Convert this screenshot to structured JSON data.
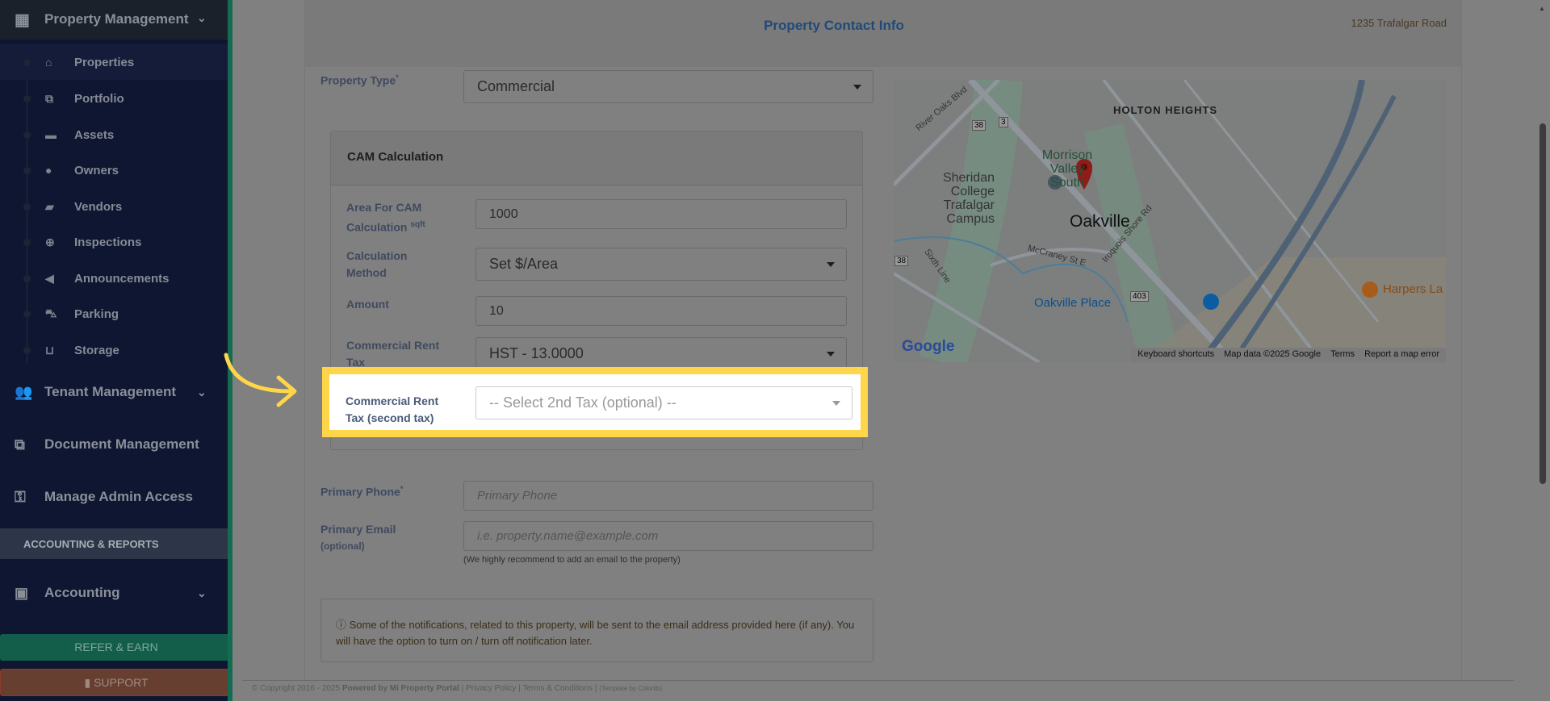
{
  "sidebar": {
    "section_title": "Property Management",
    "sub_items": [
      {
        "label": "Properties",
        "icon": "home-icon"
      },
      {
        "label": "Portfolio",
        "icon": "portfolio-icon"
      },
      {
        "label": "Assets",
        "icon": "archive-icon"
      },
      {
        "label": "Owners",
        "icon": "user-icon"
      },
      {
        "label": "Vendors",
        "icon": "briefcase-icon"
      },
      {
        "label": "Inspections",
        "icon": "search-plus-icon"
      },
      {
        "label": "Announcements",
        "icon": "bullhorn-icon"
      },
      {
        "label": "Parking",
        "icon": "car-icon"
      },
      {
        "label": "Storage",
        "icon": "basket-icon"
      }
    ],
    "tenant": "Tenant Management",
    "document": "Document Management",
    "admin": "Manage Admin Access",
    "accounting_header": "ACCOUNTING & REPORTS",
    "accounting": "Accounting",
    "refer": "REFER & EARN",
    "support": "SUPPORT"
  },
  "panel": {
    "title": "Property Contact Info",
    "address": "1235 Trafalgar Road"
  },
  "form": {
    "property_type_label": "Property Type",
    "required_mark": "*",
    "property_type_value": "Commercial",
    "cam_title": "CAM Calculation",
    "area_label": "Area For CAM Calculation",
    "area_unit": "sqft",
    "area_value": "1000",
    "method_label": "Calculation Method",
    "method_value": "Set $/Area",
    "amount_label": "Amount",
    "amount_value": "10",
    "tax_label": "Commercial Rent Tax",
    "tax_value": "HST - 13.0000",
    "tax2_label": "Commercial Rent Tax (second tax)",
    "tax2_placeholder": "-- Select 2nd Tax (optional) --",
    "phone_label": "Primary Phone",
    "phone_placeholder": "Primary Phone",
    "email_label": "Primary Email",
    "email_optional": "(optional)",
    "email_placeholder": "i.e. property.name@example.com",
    "email_hint": "(We highly recommend to add an email to the property)",
    "notice": "Some of the notifications, related to this property, will be sent to the email address provided here (if any). You will have the option to turn on / turn off notification later."
  },
  "map": {
    "labels": [
      "HOLTON HEIGHTS",
      "Morrison Valley South",
      "Sheridan College Trafalgar Campus",
      "Oakville",
      "Oakville Place",
      "Harpers La",
      "River Oaks Blvd",
      "Sixth Line",
      "McCraney St E",
      "Iroquois Shore Rd",
      "38",
      "3",
      "403"
    ],
    "google": "Google",
    "footer": [
      "Keyboard shortcuts",
      "Map data ©2025 Google",
      "Terms",
      "Report a map error"
    ]
  },
  "footer": {
    "copyright": "© Copyright 2016 - 2025",
    "powered": "Powered by Mi Property Portal",
    "privacy": "Privacy Policy",
    "terms": "Terms & Conditions",
    "template": "(Template by Colorlib)"
  },
  "colors": {
    "highlight": "#ffd54a",
    "title": "#1f4a7a",
    "refer": "#135e4a",
    "support": "#663f31"
  }
}
